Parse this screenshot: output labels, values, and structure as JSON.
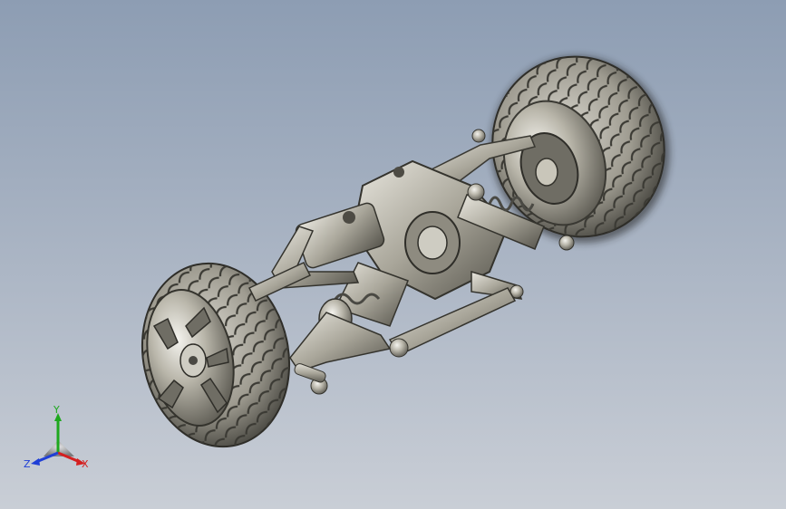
{
  "viewport": {
    "background_top": "#8d9db3",
    "background_bottom": "#c9ced6",
    "model_name": "rc-car-axle-suspension-assembly"
  },
  "triad": {
    "x_label": "X",
    "y_label": "Y",
    "z_label": "Z",
    "x_color": "#d42020",
    "y_color": "#1ea81e",
    "z_color": "#1f3fd6"
  }
}
